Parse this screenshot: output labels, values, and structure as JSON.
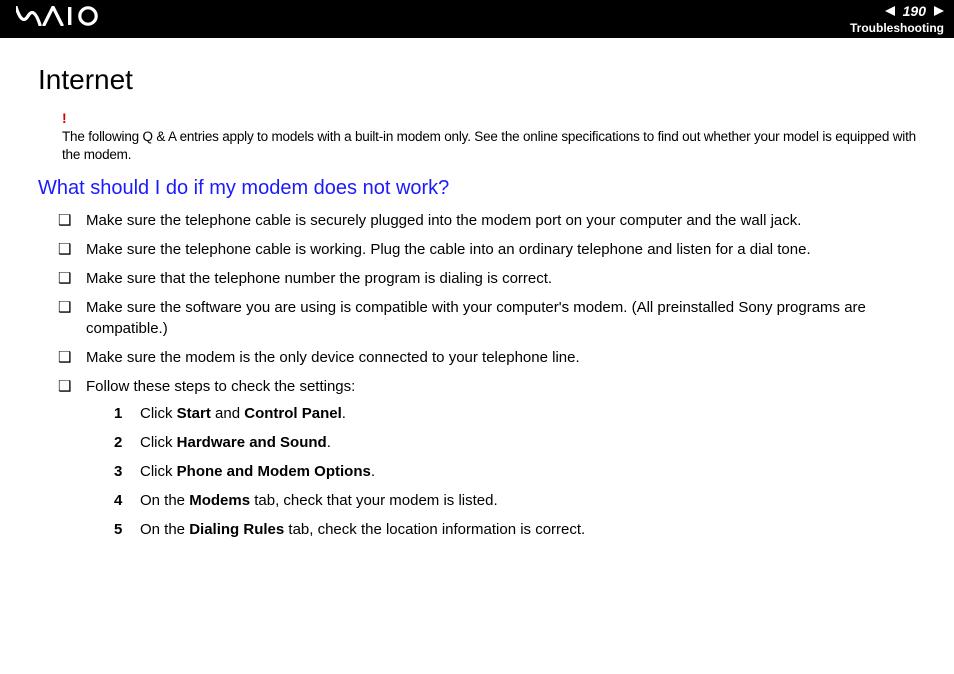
{
  "header": {
    "logo": "VAIO",
    "page_number": "190",
    "section": "Troubleshooting"
  },
  "title": "Internet",
  "note": {
    "bang": "!",
    "text": "The following Q & A entries apply to models with a built-in modem only. See the online specifications to find out whether your model is equipped with the modem."
  },
  "question": "What should I do if my modem does not work?",
  "bullets": [
    "Make sure the telephone cable is securely plugged into the modem port on your computer and the wall jack.",
    "Make sure the telephone cable is working. Plug the cable into an ordinary telephone and listen for a dial tone.",
    "Make sure that the telephone number the program is dialing is correct.",
    "Make sure the software you are using is compatible with your computer's modem. (All preinstalled Sony programs are compatible.)",
    "Make sure the modem is the only device connected to your telephone line.",
    "Follow these steps to check the settings:"
  ],
  "steps": [
    {
      "num": "1",
      "pre": "Click ",
      "b1": "Start",
      "mid": " and ",
      "b2": "Control Panel",
      "post": "."
    },
    {
      "num": "2",
      "pre": "Click ",
      "b1": "Hardware and Sound",
      "mid": "",
      "b2": "",
      "post": "."
    },
    {
      "num": "3",
      "pre": "Click ",
      "b1": "Phone and Modem Options",
      "mid": "",
      "b2": "",
      "post": "."
    },
    {
      "num": "4",
      "pre": "On the ",
      "b1": "Modems",
      "mid": " tab, check that your modem is listed.",
      "b2": "",
      "post": ""
    },
    {
      "num": "5",
      "pre": "On the ",
      "b1": "Dialing Rules",
      "mid": " tab, check the location information is correct.",
      "b2": "",
      "post": ""
    }
  ]
}
